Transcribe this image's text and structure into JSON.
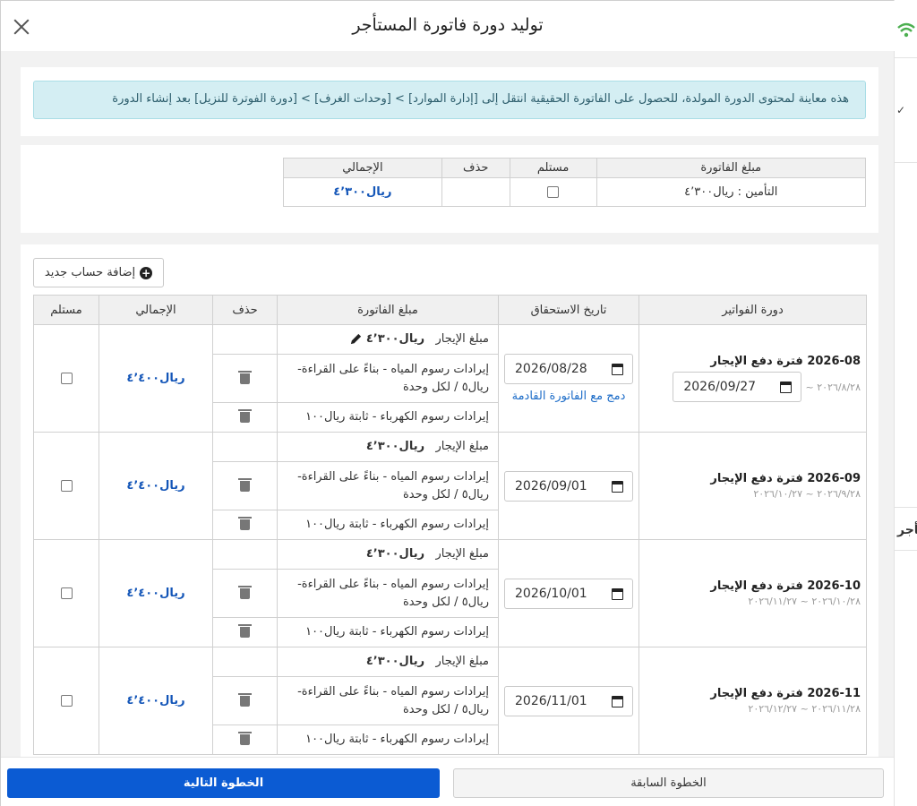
{
  "dialog": {
    "title": "توليد دورة فاتورة المستأجر",
    "info": "هذه معاينة لمحتوى الدورة المولدة، للحصول على الفاتورة الحقيقية انتقل إلى [إدارة الموارد] > [وحدات الغرف] > [دورة الفوترة للنزيل] بعد إنشاء الدورة"
  },
  "background": {
    "side_text": "تأجر"
  },
  "deposit": {
    "headers": {
      "amount": "مبلغ الفاتورة",
      "received": "مستلم",
      "delete": "حذف",
      "total": "الإجمالي"
    },
    "row": {
      "label": "التأمين : ريال٤٬٣٠٠",
      "total": "ريال٤٬٣٠٠"
    }
  },
  "bills": {
    "add_account_label": "إضافة حساب جديد",
    "headers": {
      "period": "دورة الفواتير",
      "due": "تاريخ الاستحقاق",
      "amount": "مبلغ الفاتورة",
      "delete": "حذف",
      "total": "الإجمالي",
      "received": "مستلم"
    },
    "periods": [
      {
        "title": "2026-08 فترة دفع الإيجار",
        "range_start": "٢٠٢٦/٨/٢٨ ~",
        "end_date": "2026/09/27",
        "due_date": "2026/08/28",
        "merge_link": "دمج مع الفاتورة القادمة",
        "rent_label": "مبلغ الإيجار",
        "rent_amount": "ريال٤٬٣٠٠",
        "water": "إيرادات رسوم المياه - بناءً على القراءة- ريال٥ / لكل وحدة",
        "electricity": "إيرادات رسوم الكهرباء - ثابتة ريال١٠٠",
        "total": "ريال٤٬٤٠٠"
      },
      {
        "title": "2026-09 فترة دفع الإيجار",
        "range": "٢٠٢٦/٩/٢٨ ~ ٢٠٢٦/١٠/٢٧",
        "due_date": "2026/09/01",
        "rent_label": "مبلغ الإيجار",
        "rent_amount": "ريال٤٬٣٠٠",
        "water": "إيرادات رسوم المياه - بناءً على القراءة- ريال٥ / لكل وحدة",
        "electricity": "إيرادات رسوم الكهرباء - ثابتة ريال١٠٠",
        "total": "ريال٤٬٤٠٠"
      },
      {
        "title": "2026-10 فترة دفع الإيجار",
        "range": "٢٠٢٦/١٠/٢٨ ~ ٢٠٢٦/١١/٢٧",
        "due_date": "2026/10/01",
        "rent_label": "مبلغ الإيجار",
        "rent_amount": "ريال٤٬٣٠٠",
        "water": "إيرادات رسوم المياه - بناءً على القراءة- ريال٥ / لكل وحدة",
        "electricity": "إيرادات رسوم الكهرباء - ثابتة ريال١٠٠",
        "total": "ريال٤٬٤٠٠"
      },
      {
        "title": "2026-11 فترة دفع الإيجار",
        "range": "٢٠٢٦/١١/٢٨ ~ ٢٠٢٦/١٢/٢٧",
        "due_date": "2026/11/01",
        "rent_label": "مبلغ الإيجار",
        "rent_amount": "ريال٤٬٣٠٠",
        "water": "إيرادات رسوم المياه - بناءً على القراءة- ريال٥ / لكل وحدة",
        "electricity": "إيرادات رسوم الكهرباء - ثابتة ريال١٠٠",
        "total": "ريال٤٬٤٠٠"
      }
    ]
  },
  "footer": {
    "next_label": "الخطوة التالية",
    "prev_label": "الخطوة السابقة"
  },
  "colors": {
    "primary": "#0b5bd3",
    "link": "#1c6cc8",
    "amount": "#1456b8",
    "alert_bg": "#d4eef3"
  }
}
